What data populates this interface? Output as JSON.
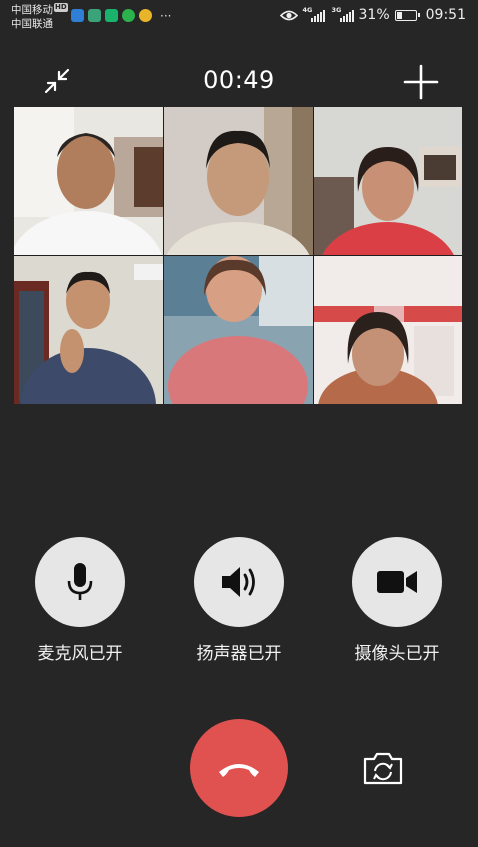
{
  "status_bar": {
    "carrier1": "中国移动",
    "carrier1_badge": "HD",
    "carrier2": "中国联通",
    "signal1_type": "4G",
    "signal2_type": "3G",
    "battery": "31%",
    "battery_level": 0.31,
    "time": "09:51",
    "app_icons": [
      "shield-app-icon",
      "photo-app-icon",
      "security-app-icon",
      "video-app-icon",
      "weibo-app-icon"
    ],
    "more": "···"
  },
  "call": {
    "duration": "00:49"
  },
  "participants": [
    {
      "id": "participant-1"
    },
    {
      "id": "participant-2"
    },
    {
      "id": "participant-3"
    },
    {
      "id": "participant-4"
    },
    {
      "id": "participant-5"
    },
    {
      "id": "participant-6"
    }
  ],
  "controls": {
    "microphone_label": "麦克风已开",
    "speaker_label": "扬声器已开",
    "camera_label": "摄像头已开"
  },
  "colors": {
    "background": "#262626",
    "control_circle": "#e6e6e6",
    "hangup": "#e05250"
  }
}
